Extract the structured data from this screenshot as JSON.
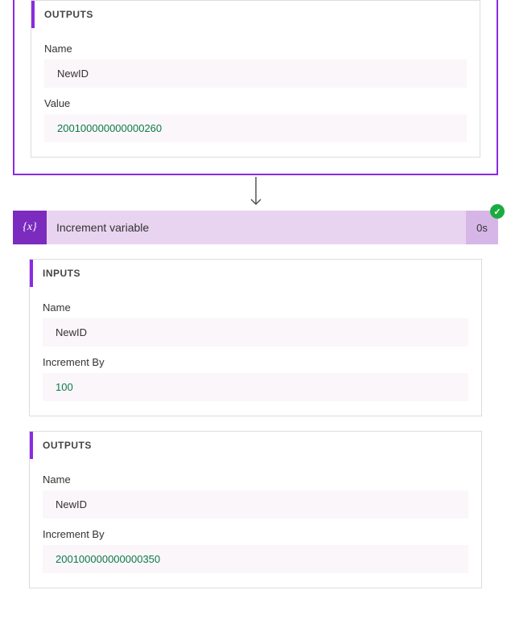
{
  "topStep": {
    "outputs": {
      "header": "OUTPUTS",
      "fields": {
        "nameLabel": "Name",
        "nameValue": "NewID",
        "valueLabel": "Value",
        "valueValue": "200100000000000260"
      }
    }
  },
  "incrementStep": {
    "iconText": "{x}",
    "title": "Increment variable",
    "duration": "0s",
    "statusIcon": "✓",
    "inputs": {
      "header": "INPUTS",
      "fields": {
        "nameLabel": "Name",
        "nameValue": "NewID",
        "incLabel": "Increment By",
        "incValue": "100"
      }
    },
    "outputs": {
      "header": "OUTPUTS",
      "fields": {
        "nameLabel": "Name",
        "nameValue": "NewID",
        "incLabel": "Increment By",
        "incValue": "200100000000000350"
      }
    }
  }
}
